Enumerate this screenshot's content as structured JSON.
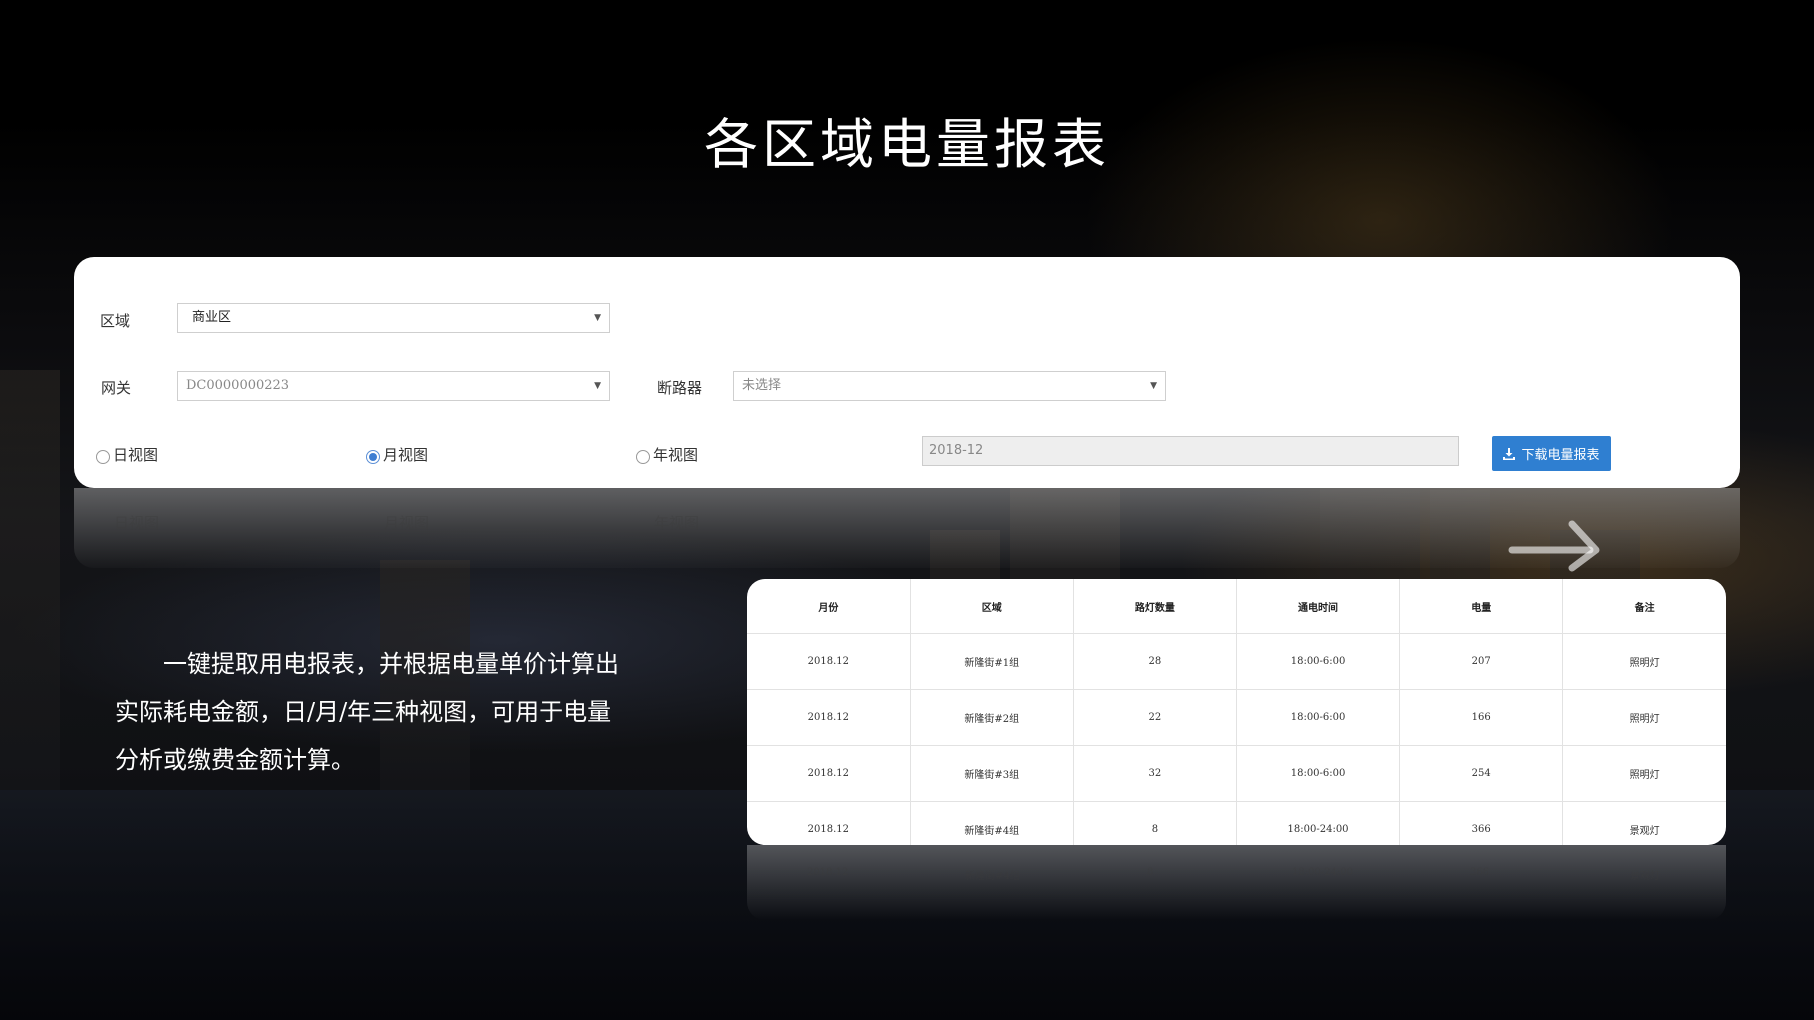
{
  "title": "各区域电量报表",
  "filters": {
    "area_label": "区域",
    "area_value": "商业区",
    "gateway_label": "网关",
    "gateway_value": "DC0000000223",
    "breaker_label": "断路器",
    "breaker_value": "未选择",
    "view_options": [
      {
        "label": "日视图",
        "selected": false
      },
      {
        "label": "月视图",
        "selected": true
      },
      {
        "label": "年视图",
        "selected": false
      }
    ],
    "date_value": "2018-12",
    "download_label": "下载电量报表"
  },
  "description": "一键提取用电报表，并根据电量单价计算出实际耗电金额，日/月/年三种视图，可用于电量分析或缴费金额计算。",
  "table": {
    "headers": [
      "月份",
      "区域",
      "路灯数量",
      "通电时间",
      "电量",
      "备注"
    ],
    "rows": [
      [
        "2018.12",
        "新隆街#1组",
        "28",
        "18:00-6:00",
        "207",
        "照明灯"
      ],
      [
        "2018.12",
        "新隆街#2组",
        "22",
        "18:00-6:00",
        "166",
        "照明灯"
      ],
      [
        "2018.12",
        "新隆街#3组",
        "32",
        "18:00-6:00",
        "254",
        "照明灯"
      ],
      [
        "2018.12",
        "新隆街#4组",
        "8",
        "18:00-24:00",
        "366",
        "景观灯"
      ]
    ]
  },
  "colors": {
    "accent": "#2f7fd1",
    "background": "#000000",
    "panel": "#ffffff"
  }
}
